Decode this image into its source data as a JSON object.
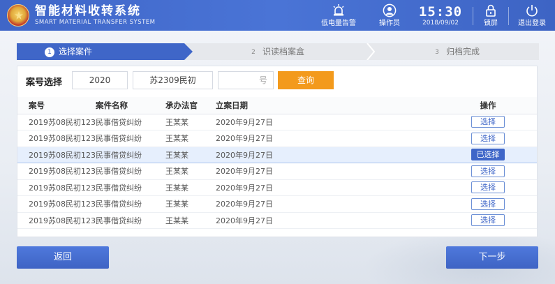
{
  "header": {
    "title_cn": "智能材料收转系统",
    "title_en": "SMART MATERIAL TRANSFER SYSTEM",
    "low_battery_label": "低电量告警",
    "operator_label": "操作员",
    "time": "15:30",
    "date": "2018/09/02",
    "lock_label": "锁屏",
    "logout_label": "退出登录"
  },
  "steps": [
    {
      "num": "1",
      "label": "选择案件",
      "active": true
    },
    {
      "num": "2",
      "label": "识读档案盒",
      "active": false
    },
    {
      "num": "3",
      "label": "归档完成",
      "active": false
    }
  ],
  "search": {
    "label": "案号选择",
    "year_value": "2020",
    "prefix_value": "苏2309民初",
    "num_placeholder": "号",
    "query_label": "查询"
  },
  "table": {
    "headers": [
      "案号",
      "案件名称",
      "承办法官",
      "立案日期",
      "操作"
    ],
    "rows": [
      {
        "case_no": "2019苏08民初123",
        "name": "民事借贷纠纷",
        "judge": "王某某",
        "date": "2020年9月27日",
        "action": "选择"
      },
      {
        "case_no": "2019苏08民初123",
        "name": "民事借贷纠纷",
        "judge": "王某某",
        "date": "2020年9月27日",
        "action": "选择"
      },
      {
        "case_no": "2019苏08民初123",
        "name": "民事借贷纠纷",
        "judge": "王某某",
        "date": "2020年9月27日",
        "action": "已选择"
      },
      {
        "case_no": "2019苏08民初123",
        "name": "民事借贷纠纷",
        "judge": "王某某",
        "date": "2020年9月27日",
        "action": "选择"
      },
      {
        "case_no": "2019苏08民初123",
        "name": "民事借贷纠纷",
        "judge": "王某某",
        "date": "2020年9月27日",
        "action": "选择"
      },
      {
        "case_no": "2019苏08民初123",
        "name": "民事借贷纠纷",
        "judge": "王某某",
        "date": "2020年9月27日",
        "action": "选择"
      },
      {
        "case_no": "2019苏08民初123",
        "name": "民事借贷纠纷",
        "judge": "王某某",
        "date": "2020年9月27日",
        "action": "选择"
      }
    ]
  },
  "footer": {
    "back_label": "返回",
    "next_label": "下一步"
  },
  "colors": {
    "primary": "#3f66c8",
    "accent": "#f39a1c"
  }
}
